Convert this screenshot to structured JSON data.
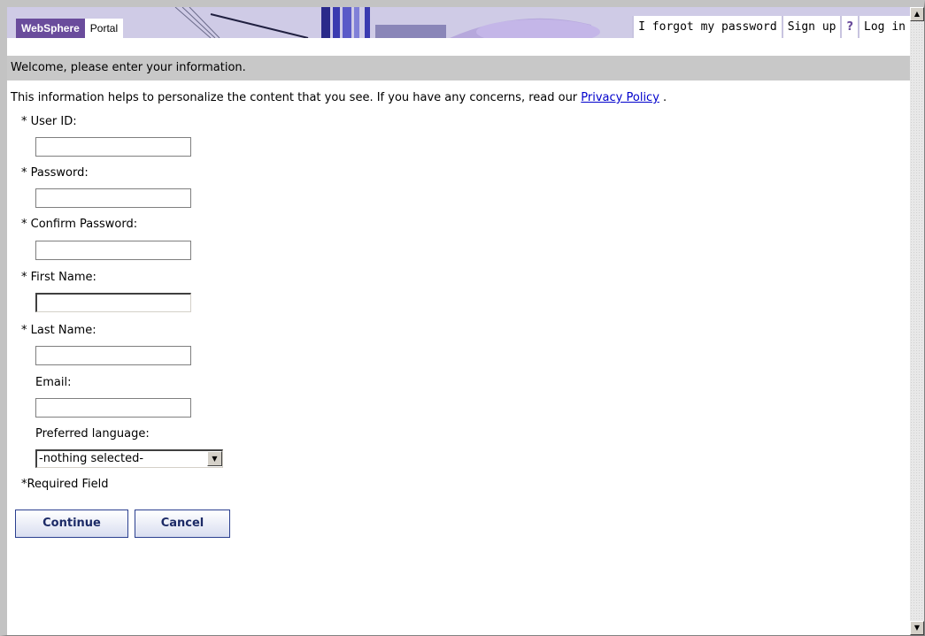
{
  "header": {
    "logo_primary": "WebSphere",
    "logo_secondary": "Portal",
    "links": {
      "forgot_password": "I forgot my password",
      "sign_up": "Sign up",
      "help": "?",
      "log_in": "Log in"
    }
  },
  "welcome_text": "Welcome, please enter your information.",
  "info": {
    "text": "This information helps to personalize the content that you see. If you have any concerns, read our",
    "privacy_link": "Privacy Policy",
    "suffix": " ."
  },
  "form": {
    "user_id_label": "* User ID:",
    "password_label": "* Password:",
    "confirm_password_label": "* Confirm Password:",
    "first_name_label": "* First Name:",
    "last_name_label": "* Last Name:",
    "email_label": "Email:",
    "language_label": "Preferred language:",
    "language_selected": "-nothing selected-",
    "required_note": "*Required Field"
  },
  "buttons": {
    "continue": "Continue",
    "cancel": "Cancel"
  },
  "colors": {
    "brand_purple": "#6a4c9c",
    "button_border": "#2a3f8f",
    "link_blue": "#0000cc"
  },
  "icons": {
    "scroll_up": "scroll-up-arrow-icon",
    "scroll_down": "scroll-down-arrow-icon",
    "dropdown": "chevron-down-icon"
  }
}
